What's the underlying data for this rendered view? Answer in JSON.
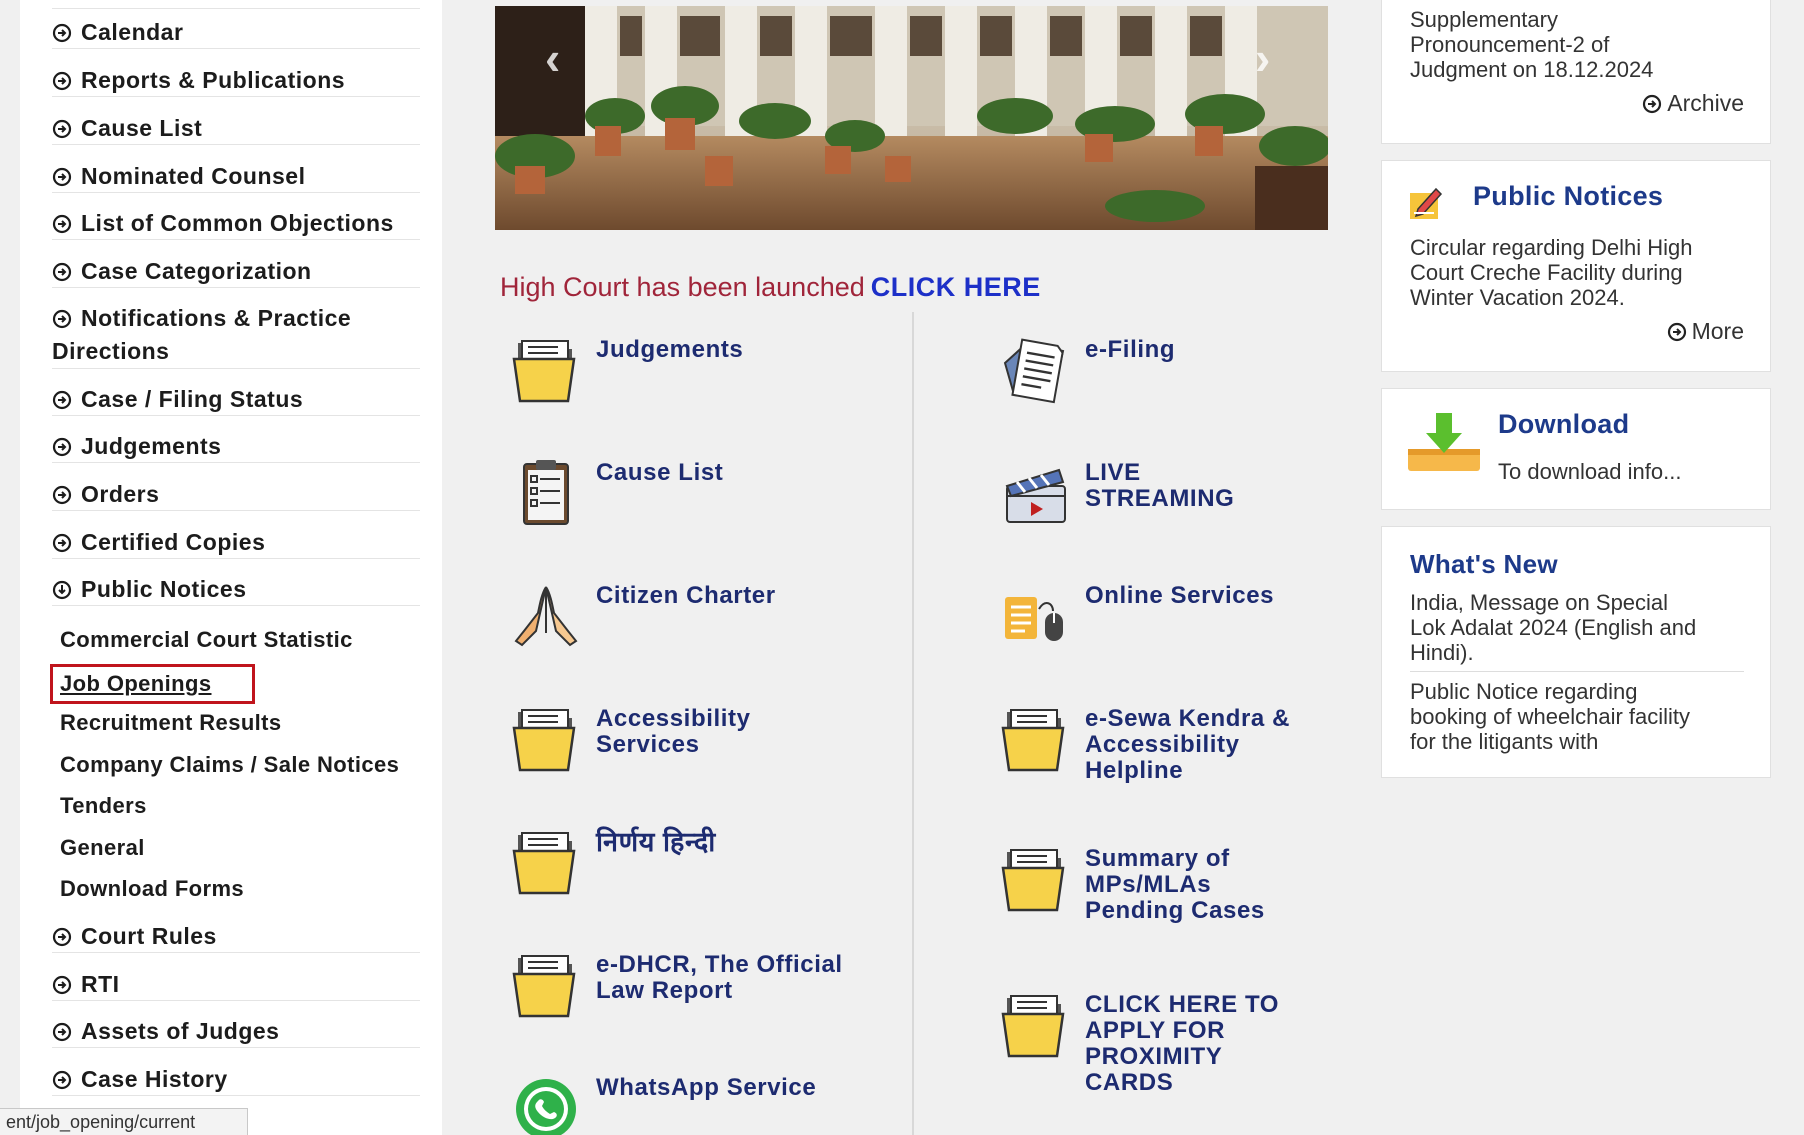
{
  "sidebar": {
    "items": [
      {
        "label": "Calendar"
      },
      {
        "label": "Reports & Publications"
      },
      {
        "label": "Cause List"
      },
      {
        "label": "Nominated Counsel"
      },
      {
        "label": "List of Common Objections"
      },
      {
        "label": "Case Categorization"
      },
      {
        "label": "Notifications & Practice"
      },
      {
        "label": "Directions"
      },
      {
        "label": "Case / Filing Status"
      },
      {
        "label": "Judgements"
      },
      {
        "label": "Orders"
      },
      {
        "label": "Certified Copies"
      },
      {
        "label": "Public Notices"
      }
    ],
    "plain_items": [
      {
        "label": "Commercial Court Statistic"
      },
      {
        "label": "Job Openings"
      },
      {
        "label": "Recruitment Results"
      },
      {
        "label": "Company Claims / Sale Notices"
      },
      {
        "label": "Tenders"
      },
      {
        "label": "General"
      },
      {
        "label": "Download Forms"
      }
    ],
    "lower_items": [
      {
        "label": "Court Rules"
      },
      {
        "label": "RTI"
      },
      {
        "label": "Assets of Judges"
      },
      {
        "label": "Case History"
      }
    ],
    "highlighted_color": "#c0141c"
  },
  "status_bar": {
    "url": "ent/job_opening/current"
  },
  "banner": {
    "prev_arrow": "‹",
    "next_arrow": "›"
  },
  "launch": {
    "text": "High Court has been launched",
    "link": "CLICK HERE"
  },
  "tiles": {
    "left": [
      {
        "label": "Judgements",
        "icon": "folder-icon"
      },
      {
        "label": "Cause List",
        "icon": "clipboard-icon"
      },
      {
        "label": "Citizen Charter",
        "icon": "praying-hands-icon"
      },
      {
        "label": "Accessibility\nServices",
        "icon": "folder-icon"
      },
      {
        "label": "निर्णय हिन्दी",
        "icon": "folder-icon"
      },
      {
        "label": "e-DHCR, The Official\nLaw Report",
        "icon": "folder-icon"
      },
      {
        "label": "WhatsApp Service",
        "icon": "whatsapp-icon"
      }
    ],
    "right": [
      {
        "label": "e-Filing",
        "icon": "document-icon"
      },
      {
        "label": "LIVE\nSTREAMING",
        "icon": "clapperboard-icon"
      },
      {
        "label": "Online Services",
        "icon": "online-services-icon"
      },
      {
        "label": "e-Sewa Kendra &\nAccessibility\nHelpline",
        "icon": "folder-icon"
      },
      {
        "label": "Summary of\nMPs/MLAs\nPending Cases",
        "icon": "folder-icon"
      },
      {
        "label": "CLICK HERE TO\nAPPLY FOR\nPROXIMITY\nCARDS",
        "icon": "folder-icon"
      }
    ]
  },
  "cards": {
    "judgments": {
      "text": "Supplementary\nPronouncement-2 of\nJudgment on 18.12.2024",
      "link": "Archive"
    },
    "public_notices": {
      "title": "Public Notices",
      "text": "Circular regarding Delhi High\nCourt Creche Facility during\nWinter Vacation 2024.",
      "link": "More"
    },
    "download": {
      "title": "Download",
      "text": "To download info..."
    },
    "whats_new": {
      "title": "What's New",
      "item1": "India, Message on Special\nLok Adalat 2024 (English and\nHindi).",
      "item2": "Public Notice regarding\nbooking of wheelchair facility\nfor the litigants with"
    }
  }
}
